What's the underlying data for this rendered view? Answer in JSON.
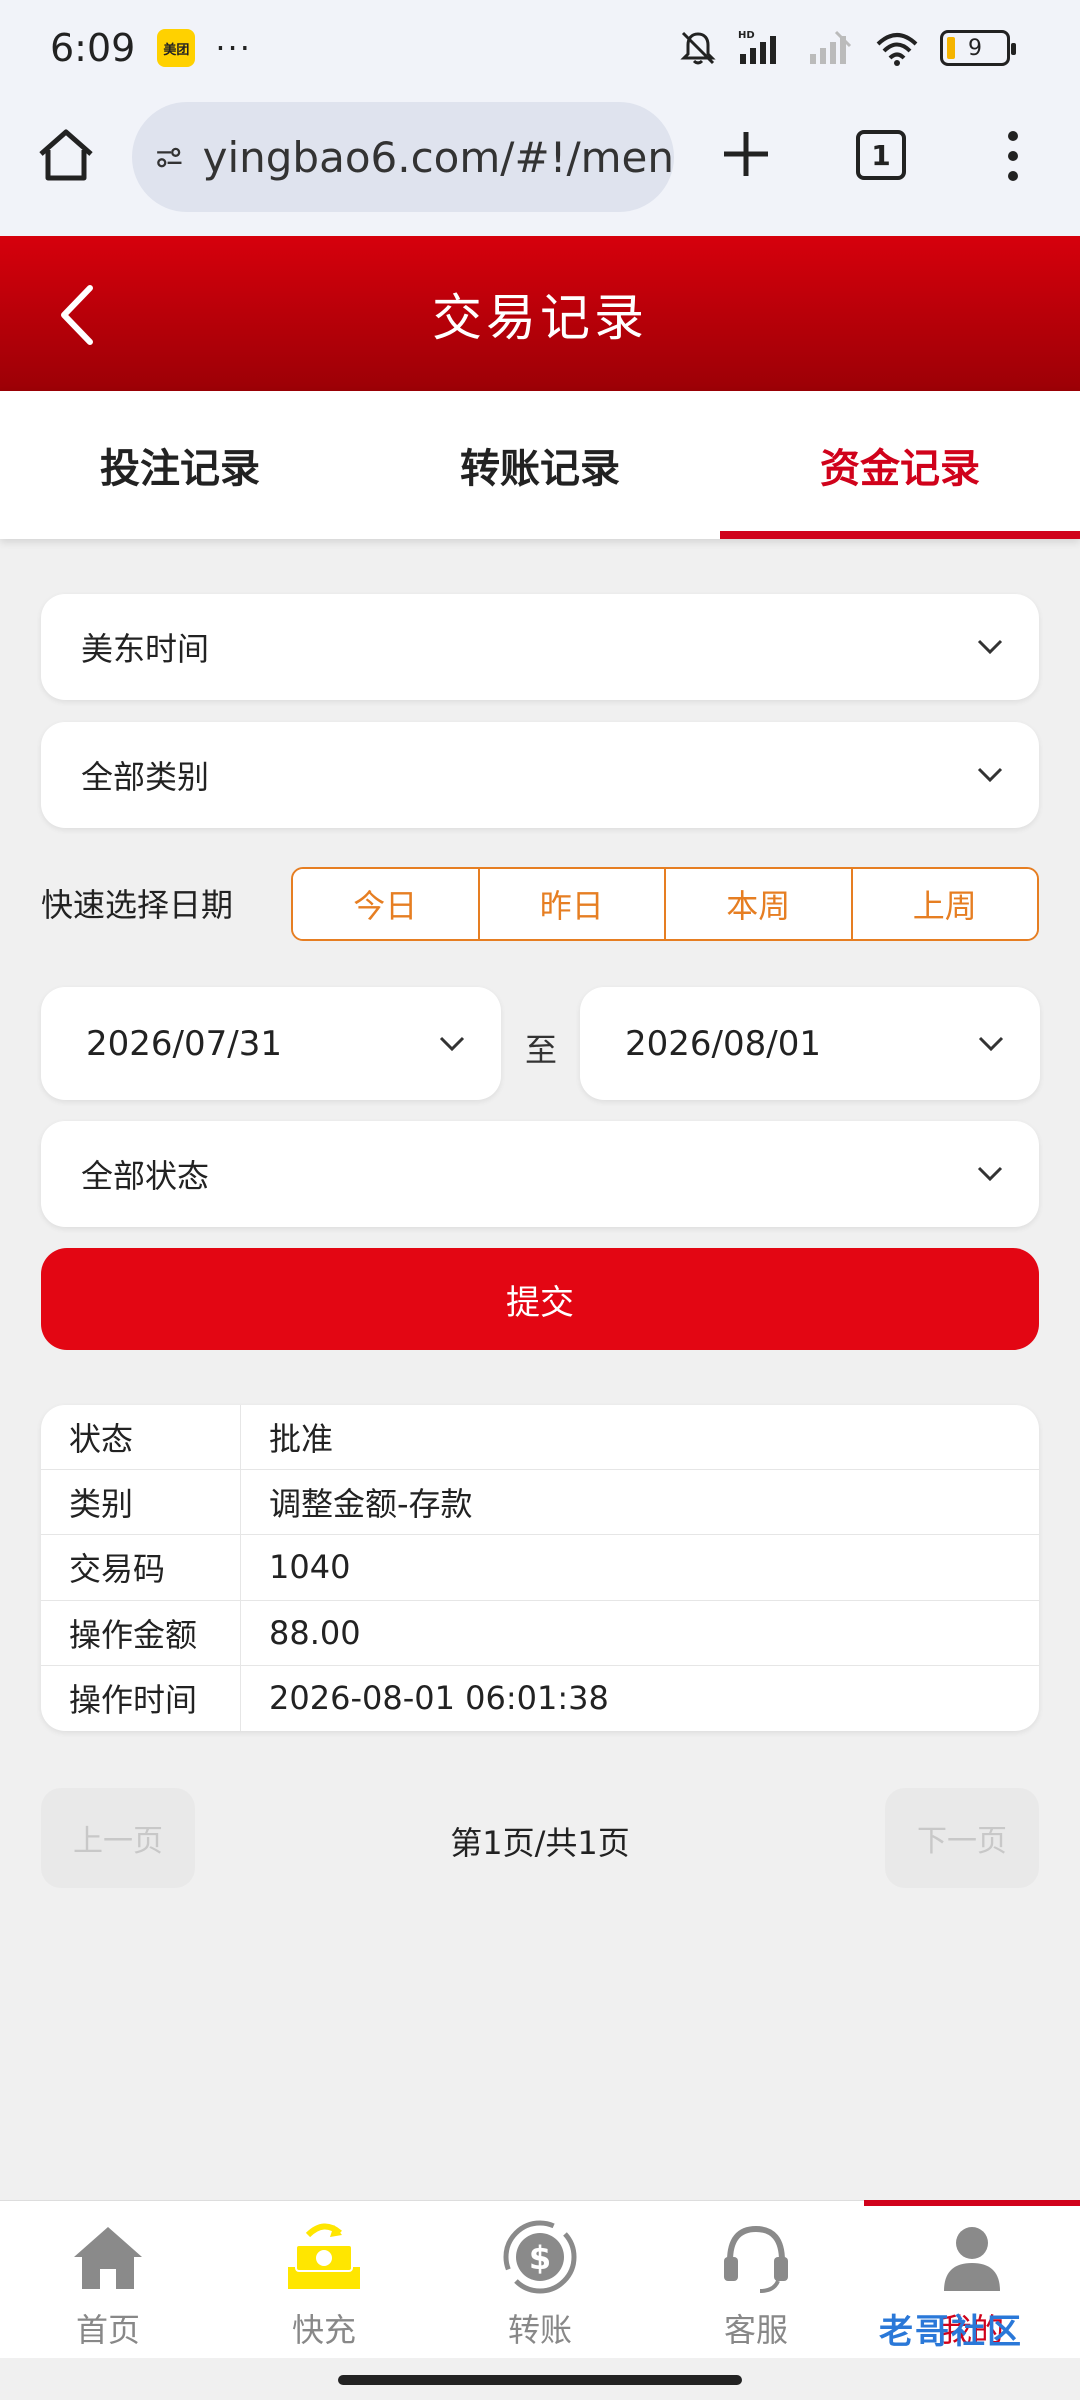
{
  "status_bar": {
    "time": "6:09",
    "app_badge": "美团",
    "battery": "9"
  },
  "browser": {
    "url": "yingbao6.com/#!/men",
    "tab_count": "1"
  },
  "header": {
    "title": "交易记录"
  },
  "tabs": [
    {
      "label": "投注记录",
      "active": false
    },
    {
      "label": "转账记录",
      "active": false
    },
    {
      "label": "资金记录",
      "active": true
    }
  ],
  "form": {
    "timezone": "美东时间",
    "category": "全部类别",
    "quick_label": "快速选择日期",
    "quick_options": [
      "今日",
      "昨日",
      "本周",
      "上周"
    ],
    "start_date": "2026/07/31",
    "to_label": "至",
    "end_date": "2026/08/01",
    "status": "全部状态",
    "submit_label": "提交"
  },
  "record": [
    {
      "key": "状态",
      "value": "批准"
    },
    {
      "key": "类别",
      "value": "调整金额-存款"
    },
    {
      "key": "交易码",
      "value": "1040"
    },
    {
      "key": "操作金额",
      "value": "88.00"
    },
    {
      "key": "操作时间",
      "value": "2026-08-01 06:01:38"
    }
  ],
  "pagination": {
    "prev": "上一页",
    "info": "第1页/共1页",
    "next": "下一页"
  },
  "bottom_nav": [
    {
      "label": "首页",
      "icon": "home-icon"
    },
    {
      "label": "快充",
      "icon": "recharge-icon"
    },
    {
      "label": "转账",
      "icon": "transfer-icon"
    },
    {
      "label": "客服",
      "icon": "headset-icon"
    },
    {
      "label": "我的",
      "icon": "user-icon",
      "active": true
    }
  ],
  "watermark": "老哥社区",
  "colors": {
    "primary": "#d0021b",
    "accent_orange": "#e67e22",
    "recharge_yellow": "#ffe600"
  }
}
